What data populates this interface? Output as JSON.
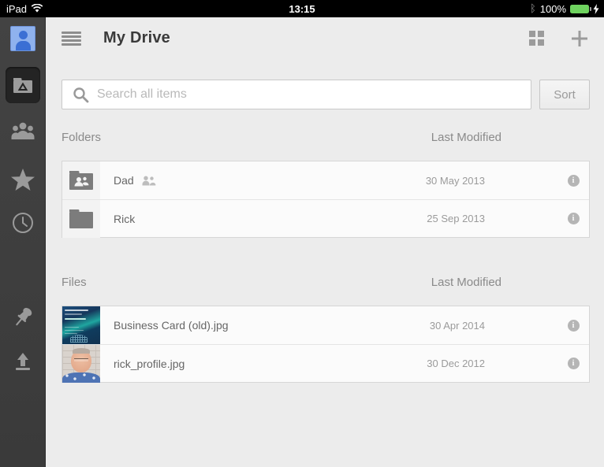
{
  "status_bar": {
    "device": "iPad",
    "time": "13:15",
    "battery_percent": "100%"
  },
  "header": {
    "title": "My Drive"
  },
  "toolbar": {
    "search_placeholder": "Search all items",
    "sort_label": "Sort"
  },
  "folders_section": {
    "label": "Folders",
    "modified_label": "Last Modified",
    "rows": [
      {
        "name": "Dad",
        "date": "30 May 2013",
        "icon": "shared-folder-icon",
        "shared": true
      },
      {
        "name": "Rick",
        "date": "25 Sep 2013",
        "icon": "folder-icon",
        "shared": false
      }
    ]
  },
  "files_section": {
    "label": "Files",
    "modified_label": "Last Modified",
    "rows": [
      {
        "name": "Business Card (old).jpg",
        "date": "30 Apr 2014",
        "icon": "image-thumbnail"
      },
      {
        "name": "rick_profile.jpg",
        "date": "30 Dec 2012",
        "icon": "image-thumbnail"
      }
    ]
  },
  "sidebar": {
    "items": [
      {
        "icon": "account-avatar"
      },
      {
        "icon": "drive-folder",
        "selected": true
      },
      {
        "icon": "shared-people"
      },
      {
        "icon": "starred"
      },
      {
        "icon": "recent-clock"
      },
      {
        "icon": "pinned"
      },
      {
        "icon": "upload"
      }
    ]
  },
  "colors": {
    "accent_blue": "#3b6fd4",
    "battery_green": "#6fd35f",
    "sidebar_bg": "#3e3e3e",
    "content_bg": "#ececec"
  }
}
